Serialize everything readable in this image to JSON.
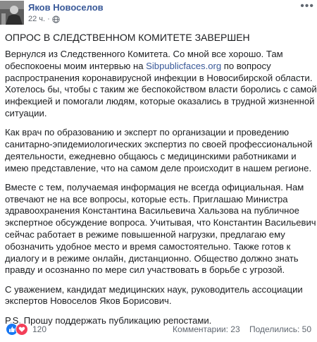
{
  "post": {
    "author": "Яков Новоселов",
    "time": "22 ч.",
    "title": "ОПРОС В СЛЕДСТВЕННОМ КОМИТЕТЕ ЗАВЕРШЕН",
    "paragraphs": [
      {
        "lines": [
          [
            {
              "t": "Вернулся из Следственного Комитета. Со мной все хорошо. Там"
            }
          ],
          [
            {
              "t": "обеспокоены моим интервью на "
            },
            {
              "t": "Sibpublicfaces.org",
              "link": true
            },
            {
              "t": " по вопросу"
            }
          ],
          [
            {
              "t": "распространения коронавирусной инфекции в Новосибирской области."
            }
          ],
          [
            {
              "t": "Хотелось бы, чтобы с таким же беспокойством власти боролись с самой"
            }
          ],
          [
            {
              "t": "инфекцией и помогали людям, которые оказались в трудной жизненной"
            }
          ],
          [
            {
              "t": "ситуации."
            }
          ]
        ]
      },
      {
        "lines": [
          [
            {
              "t": "Как врач по образованию и эксперт по организации и проведению"
            }
          ],
          [
            {
              "t": "санитарно-эпидемиологических экспертиз по своей профессиональной"
            }
          ],
          [
            {
              "t": "деятельности, ежедневно общаюсь с медицинскими работниками и"
            }
          ],
          [
            {
              "t": "имею представление, что на самом деле происходит в нашем регионе."
            }
          ]
        ]
      },
      {
        "lines": [
          [
            {
              "t": "Вместе с тем, получаемая информация не всегда официальная. Нам"
            }
          ],
          [
            {
              "t": "отвечают не на все вопросы, которые есть. Приглашаю Министра"
            }
          ],
          [
            {
              "t": "здравоохранения Константина Васильевича Хальзова на публичное"
            }
          ],
          [
            {
              "t": "экспертное обсуждение вопроса. Учитывая, что Константин Васильевич"
            }
          ],
          [
            {
              "t": "сейчас работает в режиме повышенной нагрузки, предлагаю ему"
            }
          ],
          [
            {
              "t": "обозначить удобное место и время самостоятельно. Также готов к"
            }
          ],
          [
            {
              "t": "диалогу и в режиме онлайн, дистанционно. Общество должно знать"
            }
          ],
          [
            {
              "t": "правду и осознанно по мере сил участвовать в борьбе с угрозой."
            }
          ]
        ]
      },
      {
        "lines": [
          [
            {
              "t": "С уважением, кандидат медицинских наук, руководитель ассоциации"
            }
          ],
          [
            {
              "t": "экспертов Новоселов Яков Борисович."
            }
          ]
        ]
      },
      {
        "lines": [
          [
            {
              "t": "P.S. Прошу поддержать публикацию репостами."
            }
          ]
        ]
      }
    ]
  },
  "footer": {
    "reaction_count": "120",
    "comments": "Комментарии: 23",
    "shares": "Поделились: 50"
  },
  "icons": {
    "avatar": "avatar-photo",
    "time_icon": "globe-icon",
    "more": "more-options-icon",
    "reactions": [
      "like-icon",
      "love-icon"
    ]
  },
  "colors": {
    "link": "#385898",
    "like": "#1877f2",
    "love": "#f33e58"
  }
}
